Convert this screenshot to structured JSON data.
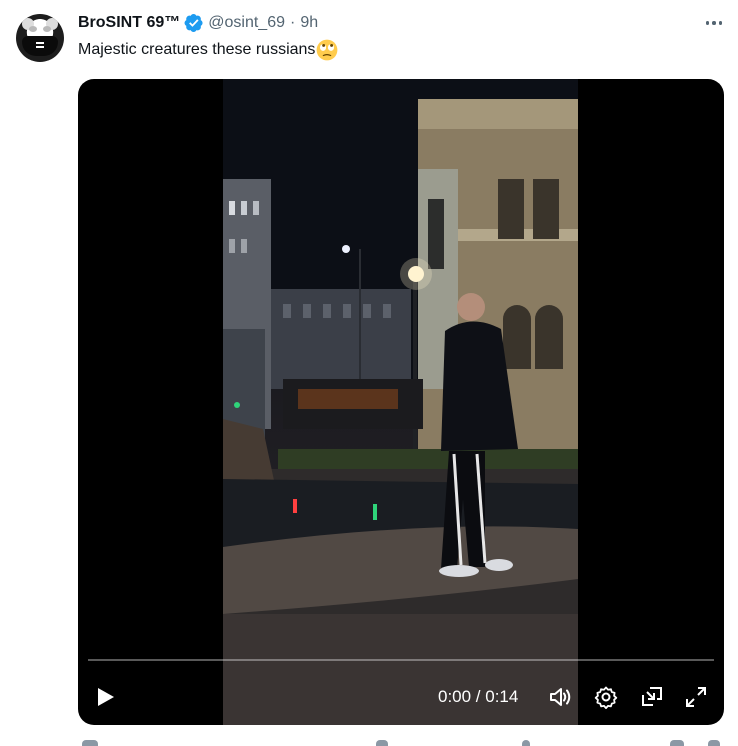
{
  "author": {
    "display_name": "BroSINT 69™",
    "handle": "@osint_69",
    "separator": "·",
    "time": "9h",
    "verified": true,
    "verified_icon": "verified-badge-icon",
    "avatar_icon": "masked-raccoon-avatar"
  },
  "tweet": {
    "text": "Majestic creatures these russians",
    "emoji": "face-with-rolling-eyes"
  },
  "menu": {
    "icon": "more-options-icon"
  },
  "video": {
    "current_time": "0:00",
    "duration": "0:14",
    "time_display": "0:00 / 0:14",
    "progress": 0.0,
    "controls": [
      "play-icon",
      "volume-icon",
      "settings-icon",
      "picture-in-picture-icon",
      "fullscreen-icon"
    ]
  },
  "colors": {
    "text_primary": "#0f1419",
    "text_secondary": "#536471",
    "verified_blue": "#1d9bf0",
    "media_bg": "#000000"
  }
}
